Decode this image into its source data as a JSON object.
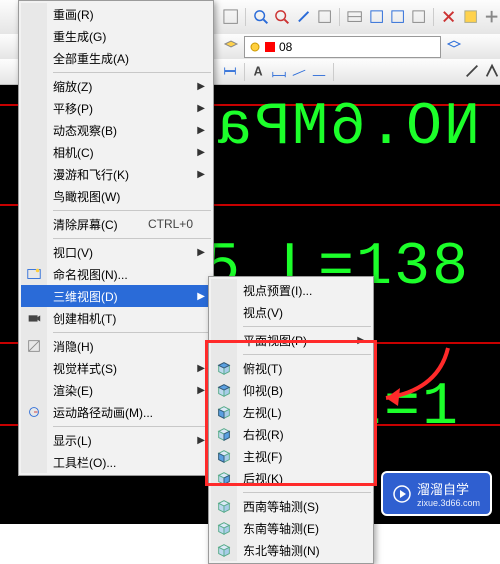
{
  "toolbar": {
    "layer_label": "08"
  },
  "canvas_text": {
    "line1": "NO.6MPa",
    "line2": "5 L=138",
    "line3": "L=1"
  },
  "menu1": [
    {
      "type": "item",
      "label": "重画(R)"
    },
    {
      "type": "item",
      "label": "重生成(G)"
    },
    {
      "type": "item",
      "label": "全部重生成(A)"
    },
    {
      "type": "divider"
    },
    {
      "type": "item",
      "label": "缩放(Z)",
      "sub": true
    },
    {
      "type": "item",
      "label": "平移(P)",
      "sub": true
    },
    {
      "type": "item",
      "label": "动态观察(B)",
      "sub": true
    },
    {
      "type": "item",
      "label": "相机(C)",
      "sub": true
    },
    {
      "type": "item",
      "label": "漫游和飞行(K)",
      "sub": true
    },
    {
      "type": "item",
      "label": "鸟瞰视图(W)"
    },
    {
      "type": "divider"
    },
    {
      "type": "item",
      "label": "清除屏幕(C)",
      "hotkey": "CTRL+0"
    },
    {
      "type": "divider"
    },
    {
      "type": "item",
      "label": "视口(V)",
      "sub": true
    },
    {
      "type": "item",
      "label": "命名视图(N)...",
      "icon": "named-view"
    },
    {
      "type": "item",
      "label": "三维视图(D)",
      "sub": true,
      "highlight": true
    },
    {
      "type": "item",
      "label": "创建相机(T)",
      "icon": "camera"
    },
    {
      "type": "divider"
    },
    {
      "type": "item",
      "label": "消隐(H)",
      "icon": "hide"
    },
    {
      "type": "item",
      "label": "视觉样式(S)",
      "sub": true
    },
    {
      "type": "item",
      "label": "渲染(E)",
      "sub": true
    },
    {
      "type": "item",
      "label": "运动路径动画(M)...",
      "icon": "motion"
    },
    {
      "type": "divider"
    },
    {
      "type": "item",
      "label": "显示(L)",
      "sub": true
    },
    {
      "type": "item",
      "label": "工具栏(O)..."
    }
  ],
  "menu2": [
    {
      "type": "item",
      "label": "视点预置(I)..."
    },
    {
      "type": "item",
      "label": "视点(V)"
    },
    {
      "type": "divider"
    },
    {
      "type": "item",
      "label": "平面视图(P)",
      "sub": true
    },
    {
      "type": "divider"
    },
    {
      "type": "item",
      "label": "俯视(T)",
      "cube": "top"
    },
    {
      "type": "item",
      "label": "仰视(B)",
      "cube": "bottom"
    },
    {
      "type": "item",
      "label": "左视(L)",
      "cube": "left"
    },
    {
      "type": "item",
      "label": "右视(R)",
      "cube": "right"
    },
    {
      "type": "item",
      "label": "主视(F)",
      "cube": "front"
    },
    {
      "type": "item",
      "label": "后视(K)",
      "cube": "back"
    },
    {
      "type": "divider"
    },
    {
      "type": "item",
      "label": "西南等轴测(S)",
      "cube": "sw"
    },
    {
      "type": "item",
      "label": "东南等轴测(E)",
      "cube": "se"
    },
    {
      "type": "item",
      "label": "东北等轴测(N)",
      "cube": "ne"
    }
  ],
  "watermark": {
    "brand": "溜溜自学",
    "url": "zixue.3d66.com"
  }
}
